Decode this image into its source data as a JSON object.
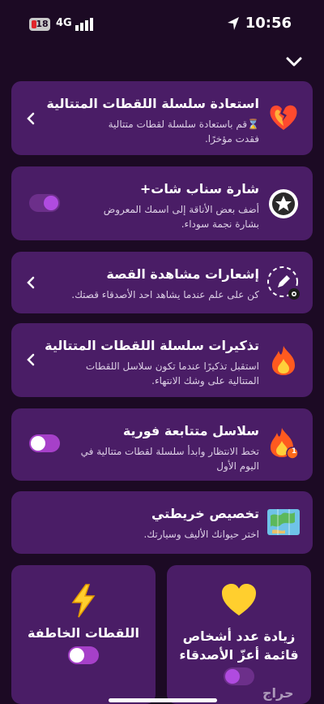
{
  "status_bar": {
    "notification_count": "18",
    "network": "4G",
    "time": "10:56"
  },
  "cards": [
    {
      "title": "استعادة سلسلة اللقطات المتتالية",
      "description": "⌛قم باستعادة سلسلة لقطات متتالية فقدت مؤخرًا.",
      "icon": "broken-heart-fire-icon",
      "control": "chevron"
    },
    {
      "title": "شارة سناب شات+",
      "description": "أضف بعض الأناقة إلى اسمك المعروض بشارة نجمة سوداء.",
      "icon": "star-badge-icon",
      "control": "toggle",
      "toggle_on": true
    },
    {
      "title": "إشعارات مشاهدة القصة",
      "description": "كن على علم عندما يشاهد احد الأصدقاء قصتك.",
      "icon": "story-eye-icon",
      "control": "chevron"
    },
    {
      "title": "تذكيرات سلسلة اللقطات المتتالية",
      "description": "استقبل تذكيرًا عندما تكون سلاسل اللقطات المتتالية على وشك الانتهاء.",
      "icon": "fire-icon",
      "control": "chevron"
    },
    {
      "title": "سلاسل متتابعة فورية",
      "description": "تخط الانتظار وابدأ سلسلة لقطات متتالية في اليوم الأول",
      "icon": "fire-badge-icon",
      "badge": "1",
      "control": "toggle",
      "toggle_on": true
    },
    {
      "title": "تخصيص خريطتي",
      "description": "اختر حيوانك الأليف وسيارتك.",
      "icon": "map-icon",
      "control": "none"
    }
  ],
  "tiles": [
    {
      "label": "زيادة عدد أشخاص قائمة أعزّ الأصدقاء",
      "icon": "yellow-heart-icon",
      "toggle_on": true
    },
    {
      "label": "اللقطات الخاطفة",
      "icon": "lightning-icon",
      "toggle_on": true
    }
  ],
  "watermark": "حراج",
  "colors": {
    "background": "#1c0a24",
    "card": "#4a1d66",
    "toggle": "#a640c9"
  }
}
